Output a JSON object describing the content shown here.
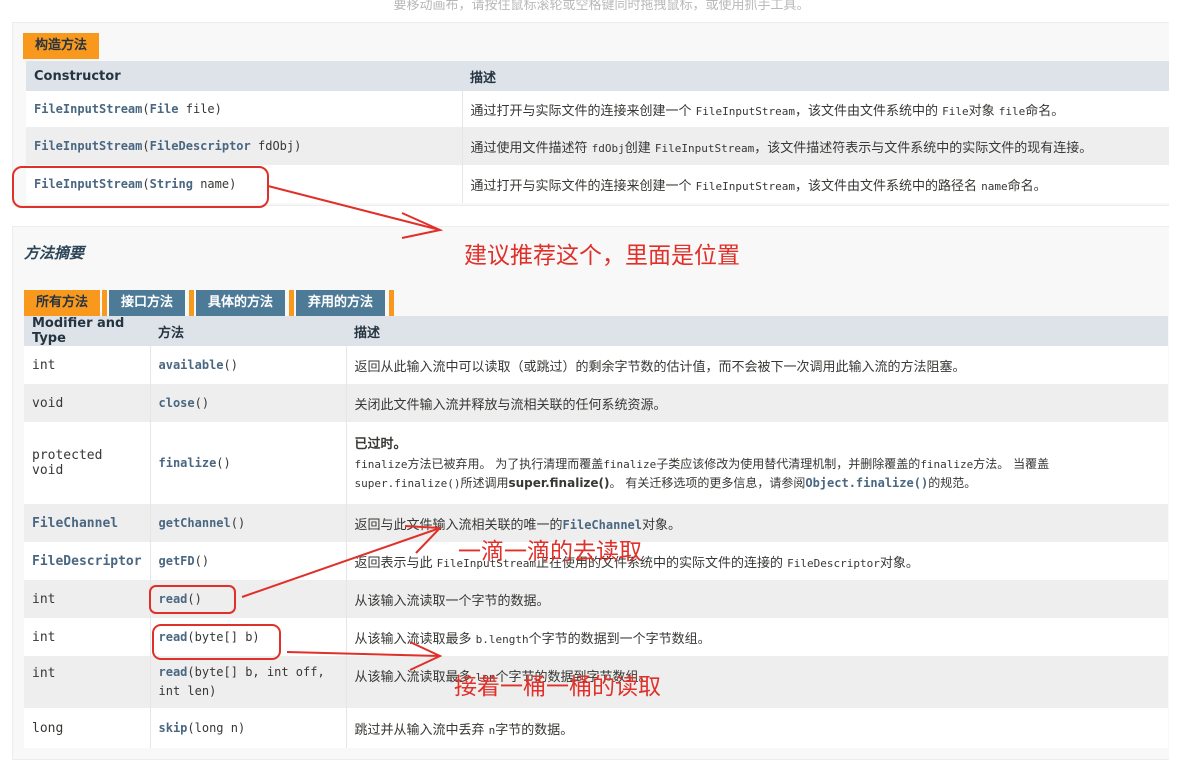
{
  "hint_text": "要移动画布，请按住鼠标滚轮或空格键同时拖拽鼠标，或使用抓手工具。",
  "constructor_section": {
    "caption": "构造方法",
    "headers": [
      "Constructor",
      "描述"
    ],
    "rows": [
      {
        "sig_name": "FileInputStream",
        "sig_open": "(",
        "sig_type": "File",
        "sig_param": " file)",
        "desc_pre": "通过打开与实际文件的连接来创建一个 ",
        "desc_code": "FileInputStream",
        "desc_mid": "，该文件由文件系统中的 ",
        "desc_code2": "File",
        "desc_mid2": "对象 ",
        "desc_code3": "file",
        "desc_post": "命名。"
      },
      {
        "sig_name": "FileInputStream",
        "sig_open": "(",
        "sig_type": "FileDescriptor",
        "sig_param": " fdObj)",
        "desc_pre": "通过使用文件描述符 ",
        "desc_code": "fdObj",
        "desc_mid": "创建 ",
        "desc_code2": "FileInputStream",
        "desc_mid2": "，该文件描述符表示与文件系统中的实际文件的现有连接。",
        "desc_code3": "",
        "desc_post": ""
      },
      {
        "sig_name": "FileInputStream",
        "sig_open": "(",
        "sig_type": "String",
        "sig_param": " name)",
        "desc_pre": "通过打开与实际文件的连接来创建一个 ",
        "desc_code": "FileInputStream",
        "desc_mid": "，该文件由文件系统中的路径名 ",
        "desc_code2": "name",
        "desc_mid2": "命名。",
        "desc_code3": "",
        "desc_post": ""
      }
    ]
  },
  "method_section": {
    "title": "方法摘要",
    "tabs": [
      "所有方法",
      "接口方法",
      "具体的方法",
      "弃用的方法"
    ],
    "headers": [
      "Modifier and Type",
      "方法",
      "描述"
    ],
    "rows": [
      {
        "type": "int",
        "method": "available",
        "params": "()",
        "desc": "返回从此输入流中可以读取（或跳过）的剩余字节数的估计值，而不会被下一次调用此输入流的方法阻塞。"
      },
      {
        "type": "void",
        "method": "close",
        "params": "()",
        "desc": "关闭此文件输入流并释放与流相关联的任何系统资源。"
      },
      {
        "type": "protected void",
        "method": "finalize",
        "params": "()",
        "deprecated_label": "已过时。",
        "desc_line1_a": "finalize",
        "desc_line1_b": "方法已被弃用。 为了执行清理而覆盖",
        "desc_line1_c": "finalize",
        "desc_line1_d": "子类应该修改为使用替代清理机制，并删除覆盖的",
        "desc_line1_e": "finalize",
        "desc_line1_f": "方法。 当覆盖",
        "desc_line2_a": "super.finalize()",
        "desc_line2_b": "所述调用",
        "desc_line2_c": "super.finalize()",
        "desc_line2_d": "。 有关迁移选项的更多信息，请参阅",
        "desc_line2_e": "Object.finalize()",
        "desc_line2_f": "的规范。"
      },
      {
        "type": "FileChannel",
        "method": "getChannel",
        "params": "()",
        "desc_pre": "返回与此文件输入流相关联的唯一的",
        "desc_code": "FileChannel",
        "desc_post": "对象。"
      },
      {
        "type": "FileDescriptor",
        "method": "getFD",
        "params": "()",
        "desc_pre": "返回表示与此 ",
        "desc_code": "FileInputStream",
        "desc_post": "正在使用的文件系统中的实际文件的连接的 ",
        "desc_code2": "FileDescriptor",
        "desc_post2": "对象。"
      },
      {
        "type": "int",
        "method": "read",
        "params": "()",
        "desc": "从该输入流读取一个字节的数据。"
      },
      {
        "type": "int",
        "method": "read",
        "params": "(byte[] b)",
        "desc_pre": "从该输入流读取最多 ",
        "desc_code": "b.length",
        "desc_post": "个字节的数据到一个字节数组。"
      },
      {
        "type": "int",
        "method": "read",
        "params": "(byte[] b, int off,",
        "params2": "int len)",
        "desc_pre": "从该输入流读取最多 ",
        "desc_code": "len",
        "desc_post": "个字节的数据到字节数组。"
      },
      {
        "type": "long",
        "method": "skip",
        "params": "(long n)",
        "desc_pre": "跳过并从输入流中丢弃 ",
        "desc_code": "n",
        "desc_post": "字节的数据。"
      }
    ]
  },
  "annotations": {
    "recommend": "建议推荐这个，里面是位置",
    "drip_read": "一滴一滴的去读取",
    "bucket_read": "接着一桶一桶的读取"
  },
  "colors": {
    "tab_active": "#f8981d",
    "tab_inactive": "#4d7a97",
    "header_bg": "#dee3e9",
    "row_alt": "#eeeeef",
    "annotation": "#e0302a"
  }
}
